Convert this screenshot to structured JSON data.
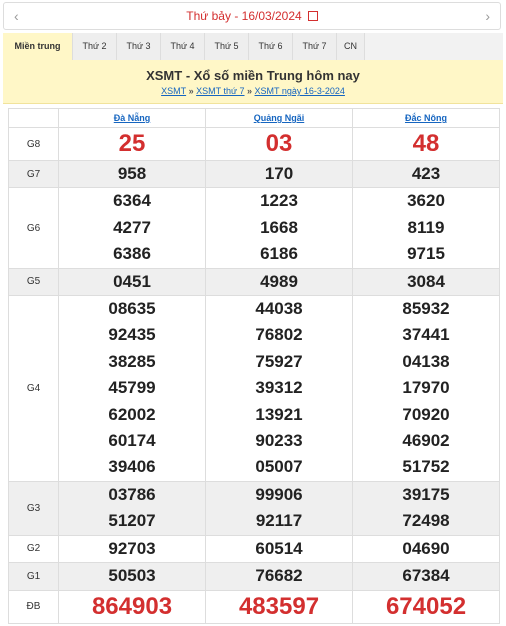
{
  "date_bar": {
    "prev": "‹",
    "next": "›",
    "date_text": "Thứ bảy -  16/03/2024"
  },
  "tabs": [
    "Miền trung",
    "Thứ 2",
    "Thứ 3",
    "Thứ 4",
    "Thứ 5",
    "Thứ 6",
    "Thứ 7",
    "CN"
  ],
  "heading": {
    "title": "XSMT - Xổ số miền Trung hôm nay",
    "breadcrumbs": [
      "XSMT",
      "XSMT thứ 7",
      "XSMT ngày 16-3-2024"
    ],
    "separator": " » "
  },
  "provinces": [
    "Đà Nẵng",
    "Quảng Ngãi",
    "Đắc Nông"
  ],
  "prizes": [
    {
      "label": "G8",
      "values": [
        [
          "25"
        ],
        [
          "03"
        ],
        [
          "48"
        ]
      ]
    },
    {
      "label": "G7",
      "values": [
        [
          "958"
        ],
        [
          "170"
        ],
        [
          "423"
        ]
      ]
    },
    {
      "label": "G6",
      "values": [
        [
          "6364",
          "4277",
          "6386"
        ],
        [
          "1223",
          "1668",
          "6186"
        ],
        [
          "3620",
          "8119",
          "9715"
        ]
      ]
    },
    {
      "label": "G5",
      "values": [
        [
          "0451"
        ],
        [
          "4989"
        ],
        [
          "3084"
        ]
      ]
    },
    {
      "label": "G4",
      "values": [
        [
          "08635",
          "92435",
          "38285",
          "45799",
          "62002",
          "60174",
          "39406"
        ],
        [
          "44038",
          "76802",
          "75927",
          "39312",
          "13921",
          "90233",
          "05007"
        ],
        [
          "85932",
          "37441",
          "04138",
          "17970",
          "70920",
          "46902",
          "51752"
        ]
      ]
    },
    {
      "label": "G3",
      "values": [
        [
          "03786",
          "51207"
        ],
        [
          "99906",
          "92117"
        ],
        [
          "39175",
          "72498"
        ]
      ]
    },
    {
      "label": "G2",
      "values": [
        [
          "92703"
        ],
        [
          "60514"
        ],
        [
          "04690"
        ]
      ]
    },
    {
      "label": "G1",
      "values": [
        [
          "50503"
        ],
        [
          "76682"
        ],
        [
          "67384"
        ]
      ]
    },
    {
      "label": "ĐB",
      "values": [
        [
          "864903"
        ],
        [
          "483597"
        ],
        [
          "674052"
        ]
      ]
    }
  ]
}
